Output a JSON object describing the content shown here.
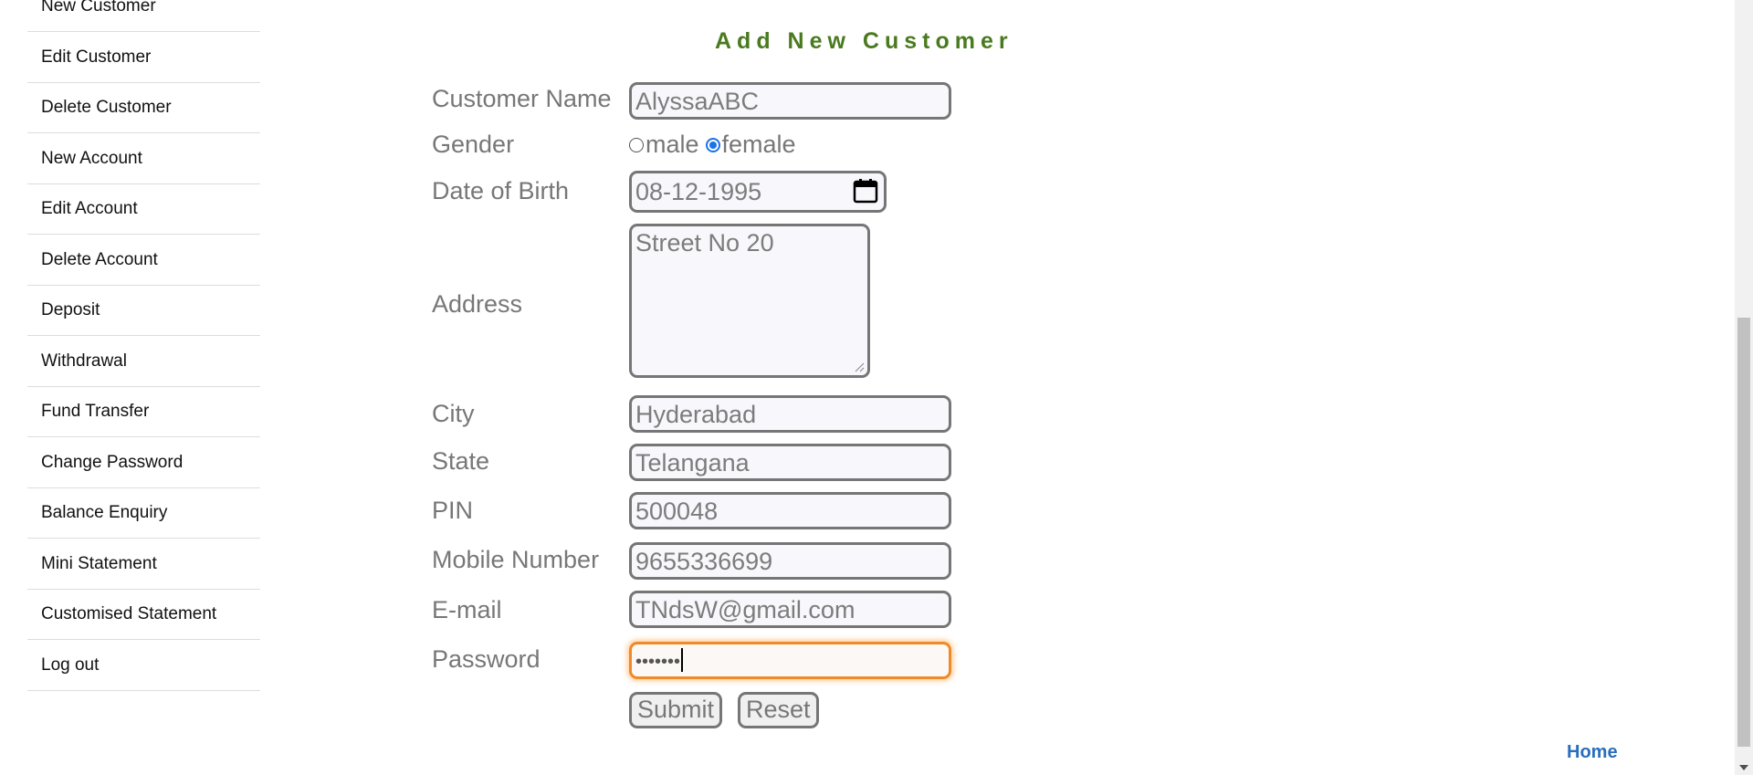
{
  "sidebar": {
    "items": [
      {
        "label": "New Customer"
      },
      {
        "label": "Edit Customer"
      },
      {
        "label": "Delete Customer"
      },
      {
        "label": "New Account"
      },
      {
        "label": "Edit Account"
      },
      {
        "label": "Delete Account"
      },
      {
        "label": "Deposit"
      },
      {
        "label": "Withdrawal"
      },
      {
        "label": "Fund Transfer"
      },
      {
        "label": "Change Password"
      },
      {
        "label": "Balance Enquiry"
      },
      {
        "label": "Mini Statement"
      },
      {
        "label": "Customised Statement"
      },
      {
        "label": "Log out"
      }
    ]
  },
  "form": {
    "title": "Add New Customer",
    "fields": {
      "customer_name": {
        "label": "Customer Name",
        "value": "AlyssaABC"
      },
      "gender": {
        "label": "Gender",
        "options": [
          "male",
          "female"
        ],
        "selected": "female"
      },
      "dob": {
        "label": "Date of Birth",
        "value": "08-12-1995"
      },
      "address": {
        "label": "Address",
        "value": "Street No 20"
      },
      "city": {
        "label": "City",
        "value": "Hyderabad"
      },
      "state": {
        "label": "State",
        "value": "Telangana"
      },
      "pin": {
        "label": "PIN",
        "value": "500048"
      },
      "mobile": {
        "label": "Mobile Number",
        "value": "9655336699"
      },
      "email": {
        "label": "E-mail",
        "value": "TNdsW@gmail.com"
      },
      "password": {
        "label": "Password",
        "value": "•••••••"
      }
    },
    "submit_label": "Submit",
    "reset_label": "Reset"
  },
  "footer": {
    "home_label": "Home",
    "link_color": "#2a6ebb"
  },
  "colors": {
    "title": "#4a7a1f",
    "focus_border": "#ee8a2a",
    "radio_checked": "#1a73e8"
  },
  "icons": {
    "date_picker": "calendar-icon",
    "textarea_resize": "resize-grip-icon"
  }
}
